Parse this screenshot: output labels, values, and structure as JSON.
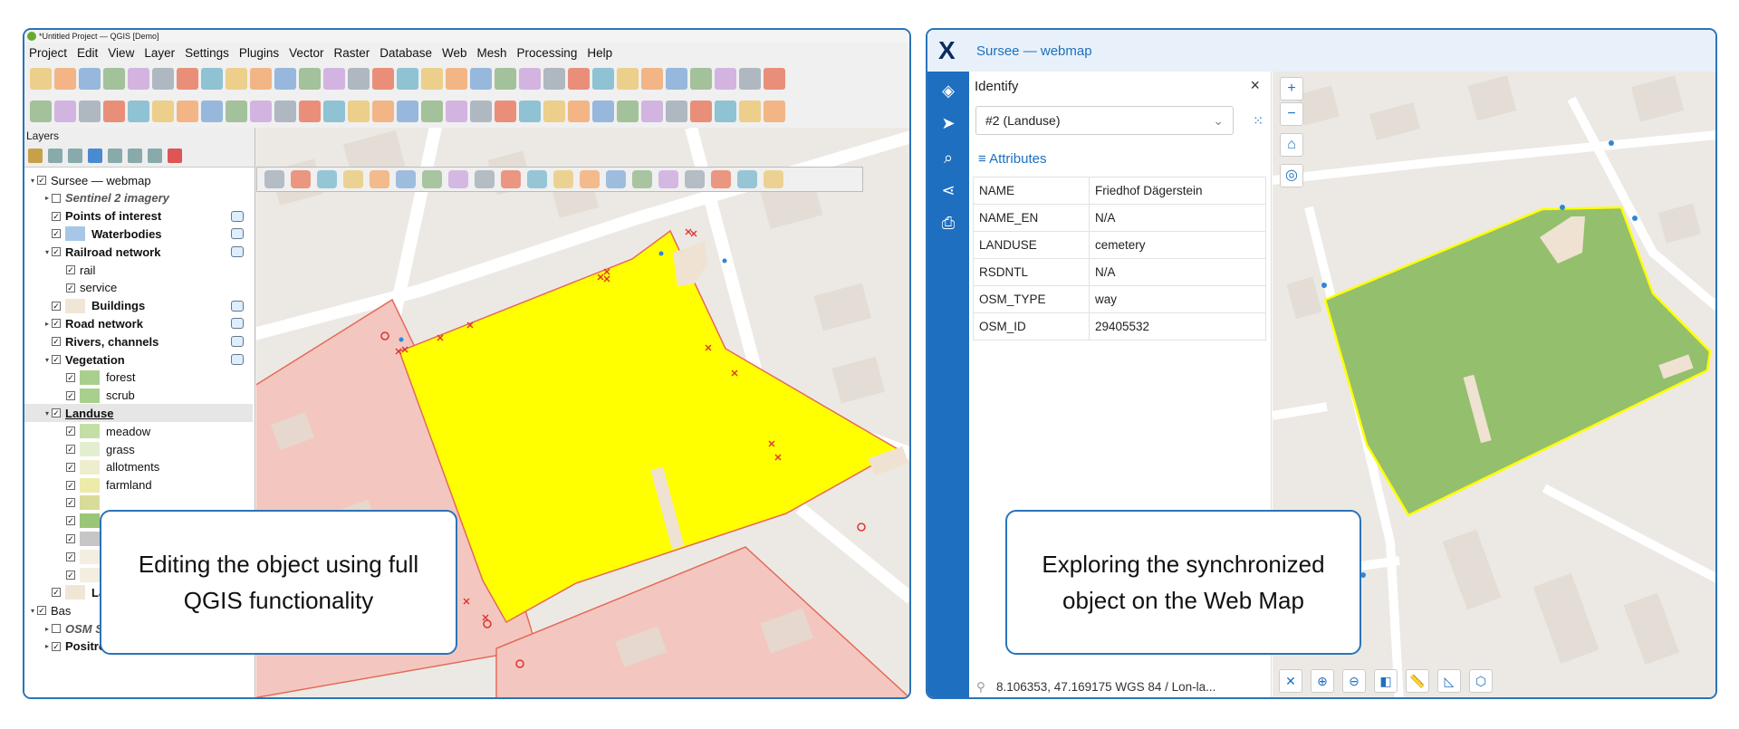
{
  "qgis": {
    "window_title": "*Untitled Project — QGIS [Demo]",
    "menu": [
      "Project",
      "Edit",
      "View",
      "Layer",
      "Settings",
      "Plugins",
      "Vector",
      "Raster",
      "Database",
      "Web",
      "Mesh",
      "Processing",
      "Help"
    ],
    "layers_panel_title": "Layers",
    "layers": [
      {
        "label": "Sursee — webmap",
        "style": "normal",
        "checked": true,
        "indent": 0,
        "arrow": "▾"
      },
      {
        "label": "Sentinel 2 imagery",
        "style": "italic",
        "checked": false,
        "indent": 1,
        "arrow": "▸"
      },
      {
        "label": "Points of interest",
        "style": "bold",
        "checked": true,
        "indent": 1,
        "arrow": ""
      },
      {
        "label": "Waterbodies",
        "style": "bold",
        "checked": true,
        "indent": 1,
        "arrow": "",
        "swatch": "#a7c7e7"
      },
      {
        "label": "Railroad network",
        "style": "bold",
        "checked": true,
        "indent": 1,
        "arrow": "▾"
      },
      {
        "label": "rail",
        "style": "normal",
        "checked": true,
        "indent": 2,
        "arrow": ""
      },
      {
        "label": "service",
        "style": "normal",
        "checked": true,
        "indent": 2,
        "arrow": ""
      },
      {
        "label": "Buildings",
        "style": "bold",
        "checked": true,
        "indent": 1,
        "arrow": "",
        "swatch": "#f1e6d6"
      },
      {
        "label": "Road network",
        "style": "bold",
        "checked": true,
        "indent": 1,
        "arrow": "▸"
      },
      {
        "label": "Rivers, channels",
        "style": "bold",
        "checked": true,
        "indent": 1,
        "arrow": ""
      },
      {
        "label": "Vegetation",
        "style": "bold",
        "checked": true,
        "indent": 1,
        "arrow": "▾"
      },
      {
        "label": "forest",
        "style": "normal",
        "checked": true,
        "indent": 2,
        "arrow": "",
        "swatch": "#a9cf8d"
      },
      {
        "label": "scrub",
        "style": "normal",
        "checked": true,
        "indent": 2,
        "arrow": "",
        "swatch": "#a9cf8d"
      },
      {
        "label": "Landuse",
        "style": "bold-underline",
        "checked": true,
        "indent": 1,
        "arrow": "▾",
        "selected": true
      },
      {
        "label": "meadow",
        "style": "normal",
        "checked": true,
        "indent": 2,
        "arrow": "",
        "swatch": "#c4dfa5"
      },
      {
        "label": "grass",
        "style": "normal",
        "checked": true,
        "indent": 2,
        "arrow": "",
        "swatch": "#e2eed0"
      },
      {
        "label": "allotments",
        "style": "normal",
        "checked": true,
        "indent": 2,
        "arrow": "",
        "swatch": "#eeeecf"
      },
      {
        "label": "farmland",
        "style": "normal",
        "checked": true,
        "indent": 2,
        "arrow": "",
        "swatch": "#eeeaa8"
      },
      {
        "label": "",
        "style": "normal",
        "checked": true,
        "indent": 2,
        "arrow": "",
        "swatch": "#d8dc98"
      },
      {
        "label": "",
        "style": "normal",
        "checked": true,
        "indent": 2,
        "arrow": "",
        "swatch": "#9bc577"
      },
      {
        "label": "",
        "style": "normal",
        "checked": true,
        "indent": 2,
        "arrow": "",
        "swatch": "#c6c6c6"
      },
      {
        "label": "",
        "style": "normal",
        "checked": true,
        "indent": 2,
        "arrow": "",
        "swatch": "#f3eee0"
      },
      {
        "label": "",
        "style": "normal",
        "checked": true,
        "indent": 2,
        "arrow": "",
        "swatch": "#f3eee0"
      },
      {
        "label": "Lan",
        "style": "bold",
        "checked": true,
        "indent": 1,
        "arrow": "",
        "swatch": "#f1e6d6"
      },
      {
        "label": "Bas",
        "style": "normal",
        "checked": true,
        "indent": 0,
        "arrow": "▾"
      },
      {
        "label": "OSM Standard",
        "style": "italic",
        "checked": false,
        "indent": 1,
        "arrow": "▸"
      },
      {
        "label": "Positron [no labels]",
        "style": "bold",
        "checked": true,
        "indent": 1,
        "arrow": "▸"
      }
    ],
    "callout": "Editing the object using full QGIS functionality"
  },
  "web": {
    "app_title": "Sursee — webmap",
    "logo": "X",
    "identify_title": "Identify",
    "feature_select": "#2 (Landuse)",
    "attributes_title": "Attributes",
    "attributes": [
      {
        "key": "NAME",
        "value": "Friedhof Dägerstein"
      },
      {
        "key": "NAME_EN",
        "value": "N/A"
      },
      {
        "key": "LANDUSE",
        "value": "cemetery"
      },
      {
        "key": "RSDNTL",
        "value": "N/A"
      },
      {
        "key": "OSM_TYPE",
        "value": "way"
      },
      {
        "key": "OSM_ID",
        "value": "29405532"
      }
    ],
    "coordinates": "8.106353, 47.169175 WGS 84 / Lon-la...",
    "callout": "Exploring the synchronized object on the Web Map"
  },
  "colors": {
    "accent": "#2b73b8",
    "rail": "#1f6fc1",
    "selection": "#ffff00",
    "cemetery": "#94bf6d",
    "landuse_red": "#f3c7bf"
  }
}
